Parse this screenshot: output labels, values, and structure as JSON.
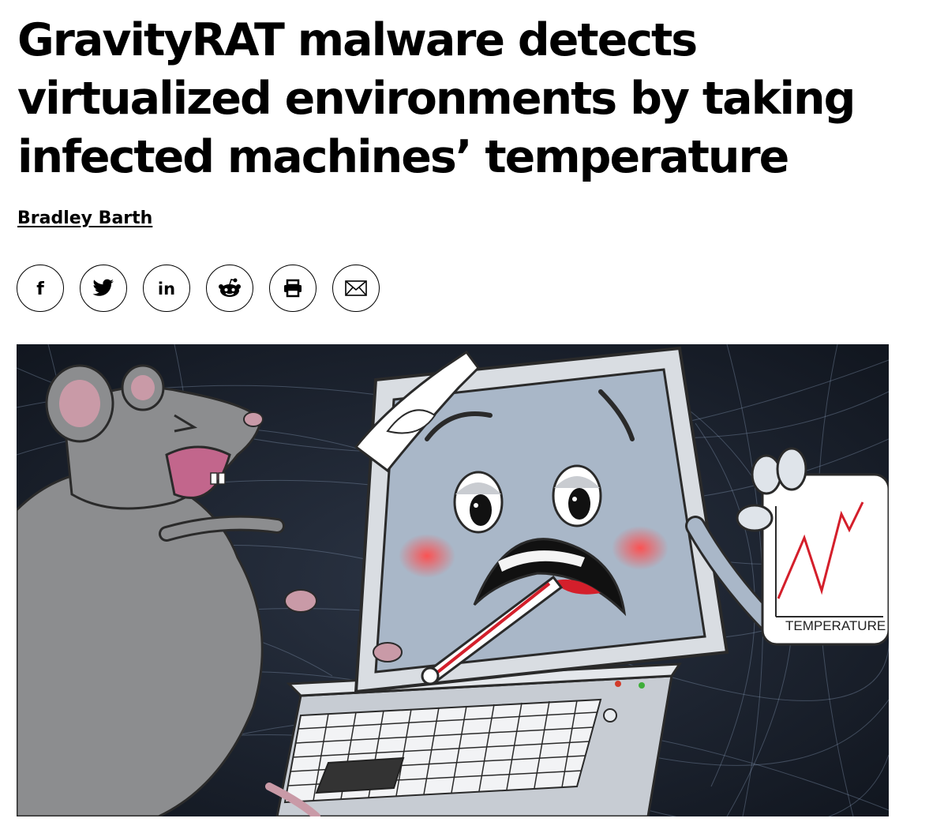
{
  "article": {
    "title": "GravityRAT malware detects virtualized environments by taking infected machines’ temperature",
    "author": "Bradley Barth"
  },
  "share_buttons": [
    {
      "icon": "facebook-icon",
      "glyph": "f"
    },
    {
      "icon": "twitter-icon"
    },
    {
      "icon": "linkedin-icon",
      "glyph": "in"
    },
    {
      "icon": "reddit-icon"
    },
    {
      "icon": "print-icon"
    },
    {
      "icon": "email-icon"
    }
  ],
  "hero_image": {
    "sign_label": "TEMPERATURE"
  }
}
